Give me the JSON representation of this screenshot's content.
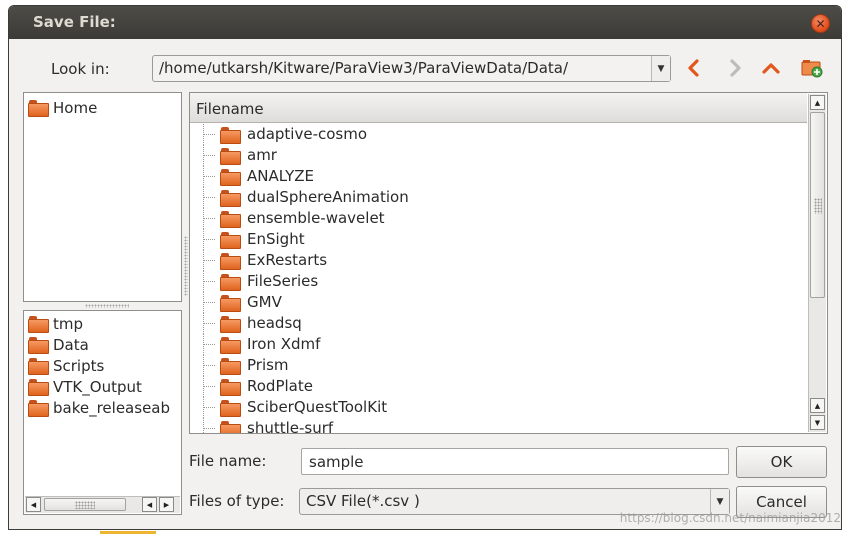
{
  "window": {
    "title": "Save File:"
  },
  "look_in": {
    "label": "Look in:",
    "path": "/home/utkarsh/Kitware/ParaView3/ParaViewData/Data/"
  },
  "places": {
    "top": [
      {
        "label": "Home"
      }
    ],
    "bottom": [
      {
        "label": "tmp"
      },
      {
        "label": "Data"
      },
      {
        "label": "Scripts"
      },
      {
        "label": "VTK_Output"
      },
      {
        "label": "bake_releaseab"
      }
    ]
  },
  "files": {
    "header": "Filename",
    "rows": [
      "adaptive-cosmo",
      "amr",
      "ANALYZE",
      "dualSphereAnimation",
      "ensemble-wavelet",
      "EnSight",
      "ExRestarts",
      "FileSeries",
      "GMV",
      "headsq",
      "Iron Xdmf",
      "Prism",
      "RodPlate",
      "SciberQuestToolKit",
      "shuttle-surf"
    ]
  },
  "file_name": {
    "label": "File name:",
    "value": "sample"
  },
  "file_type": {
    "label": "Files of type:",
    "value": "CSV File(*.csv )"
  },
  "buttons": {
    "ok": "OK",
    "cancel": "Cancel"
  },
  "watermark": "https://blog.csdn.net/naimianjia2012",
  "colors": {
    "title_bar": "#3c3b37",
    "folder": "#e96b2b",
    "close": "#df4a16",
    "nav_arrow": "#e2571c"
  }
}
